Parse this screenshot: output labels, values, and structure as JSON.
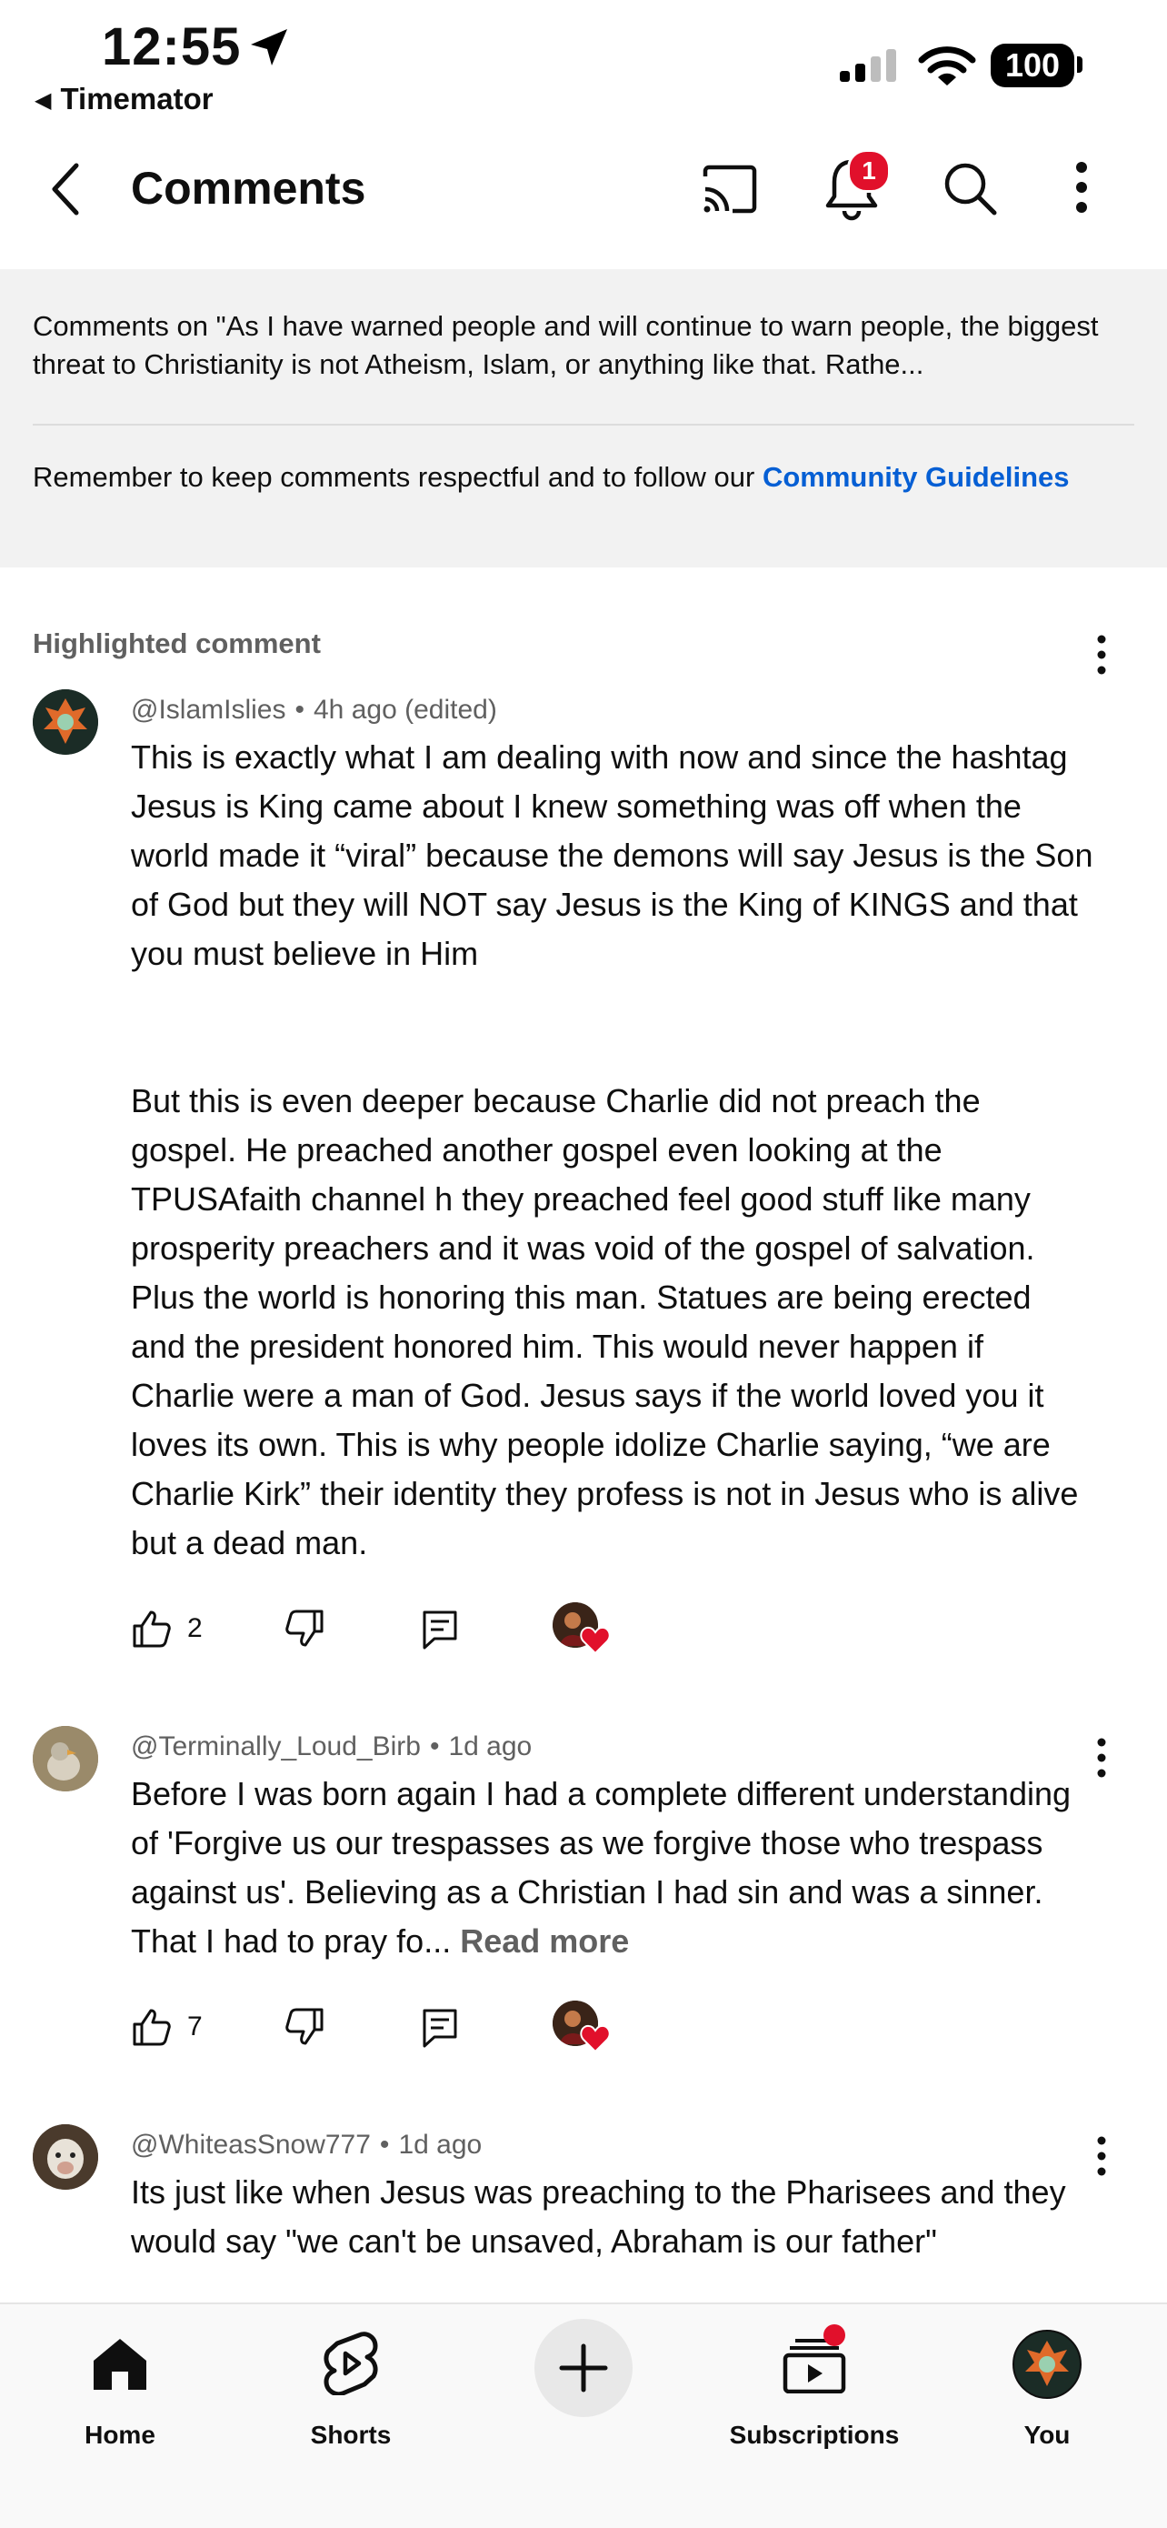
{
  "status_bar": {
    "time": "12:55",
    "back_app": "Timemator",
    "battery": "100"
  },
  "header": {
    "title": "Comments",
    "notification_count": "1"
  },
  "info": {
    "comments_on": "Comments on \"As I have warned people and will continue to warn people, the biggest threat to Christianity is not Atheism, Islam, or anything like that. Rathe...",
    "guidelines_prefix": "Remember to keep comments respectful and to follow our ",
    "guidelines_link": "Community Guidelines"
  },
  "highlighted_label": "Highlighted comment",
  "comments": [
    {
      "author": "@IslamIslies",
      "time": "4h ago (edited)",
      "paragraph1": "This is exactly what I am dealing with now and since the hashtag Jesus is King came about I knew something was off when the world made it “viral” because the demons will say Jesus is the Son of God but they will NOT say Jesus is the King of KINGS and that you must believe in Him",
      "paragraph2": "But this is even deeper because Charlie did not preach the gospel. He preached another gospel even looking at the TPUSAfaith channel h they preached feel good stuff like many prosperity preachers and it was void of the gospel of salvation. Plus the world is honoring this man. Statues are being erected and the president honored him. This would never happen if Charlie were a man of God. Jesus says if the world loved you it loves its own. This is why people idolize Charlie saying, “we are Charlie Kirk” their identity they profess is not in Jesus who is alive but a dead man.",
      "likes": "2"
    },
    {
      "author": "@Terminally_Loud_Birb",
      "time": "1d ago",
      "text": "Before I was born again I had a complete different understanding of 'Forgive us our trespasses as we forgive those who trespass against us'.  Believing as a Christian I had sin and was a sinner.  That I had to pray fo...",
      "read_more": "Read more",
      "likes": "7"
    },
    {
      "author": "@WhiteasSnow777",
      "time": "1d ago",
      "text": "Its just like when Jesus was preaching to the Pharisees and they would say \"we can't be unsaved, Abraham is our father\""
    }
  ],
  "nav": {
    "home": "Home",
    "shorts": "Shorts",
    "subscriptions": "Subscriptions",
    "you": "You"
  },
  "colors": {
    "accent_red": "#e1102b",
    "link_blue": "#065fd4",
    "secondary_text": "#606060",
    "panel_bg": "#f2f2f2"
  },
  "icons": [
    "location-arrow-icon",
    "signal-icon",
    "wifi-icon",
    "back-arrow-icon",
    "cast-icon",
    "bell-icon",
    "search-icon",
    "more-vert-icon",
    "thumb-up-icon",
    "thumb-down-icon",
    "reply-icon",
    "heart-icon",
    "home-icon",
    "shorts-icon",
    "plus-icon",
    "subscriptions-icon"
  ]
}
